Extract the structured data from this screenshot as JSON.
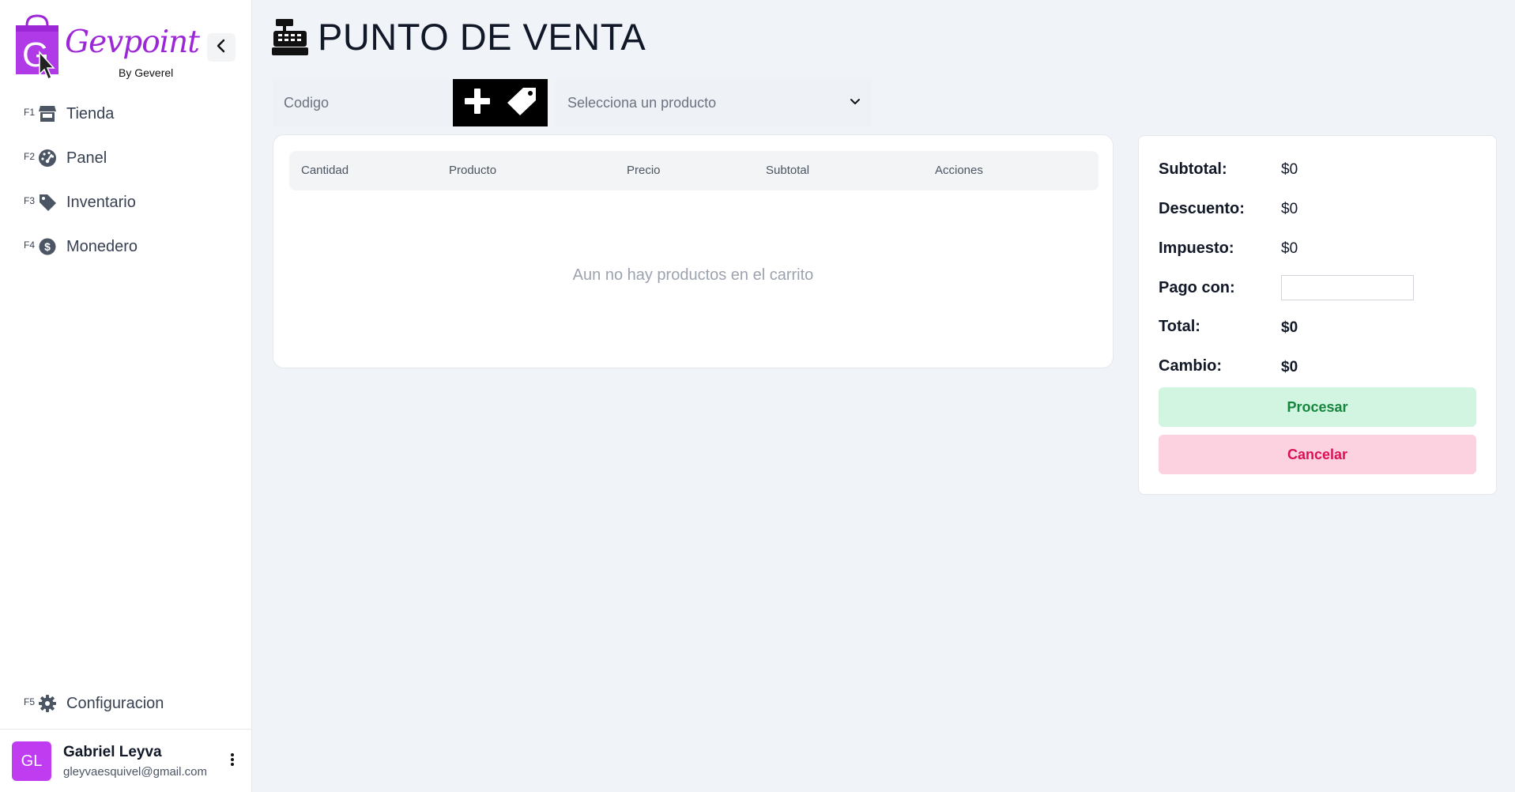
{
  "app": {
    "logo_text": "Gevpoint",
    "logo_sub": "By Geverel",
    "logo_letter": "G"
  },
  "sidebar": {
    "items": [
      {
        "key": "F1",
        "label": "Tienda",
        "icon": "store-icon"
      },
      {
        "key": "F2",
        "label": "Panel",
        "icon": "gauge-icon"
      },
      {
        "key": "F3",
        "label": "Inventario",
        "icon": "tag-icon"
      },
      {
        "key": "F4",
        "label": "Monedero",
        "icon": "dollar-circle-icon"
      }
    ],
    "config": {
      "key": "F5",
      "label": "Configuracion",
      "icon": "gear-icon"
    }
  },
  "user": {
    "initials": "GL",
    "name": "Gabriel Leyva",
    "email": "gleyvaesquivel@gmail.com"
  },
  "page": {
    "title": "PUNTO DE VENTA"
  },
  "toolbar": {
    "code_placeholder": "Codigo",
    "product_select_text": "Selecciona un producto"
  },
  "cart": {
    "columns": [
      "Cantidad",
      "Producto",
      "Precio",
      "Subtotal",
      "Acciones"
    ],
    "empty_message": "Aun no hay productos en el carrito"
  },
  "summary": {
    "subtotal_label": "Subtotal:",
    "subtotal_value": "$0",
    "discount_label": "Descuento:",
    "discount_value": "$0",
    "tax_label": "Impuesto:",
    "tax_value": "$0",
    "pay_label": "Pago con:",
    "pay_value": "",
    "total_label": "Total:",
    "total_value": "$0",
    "change_label": "Cambio:",
    "change_value": "$0",
    "process_label": "Procesar",
    "cancel_label": "Cancelar"
  },
  "colors": {
    "accent": "#9b27d6",
    "avatar": "#c03cf0",
    "process_bg": "#d1f5e0",
    "process_text": "#16863f",
    "cancel_bg": "#fdd2e0",
    "cancel_text": "#dc1155"
  }
}
